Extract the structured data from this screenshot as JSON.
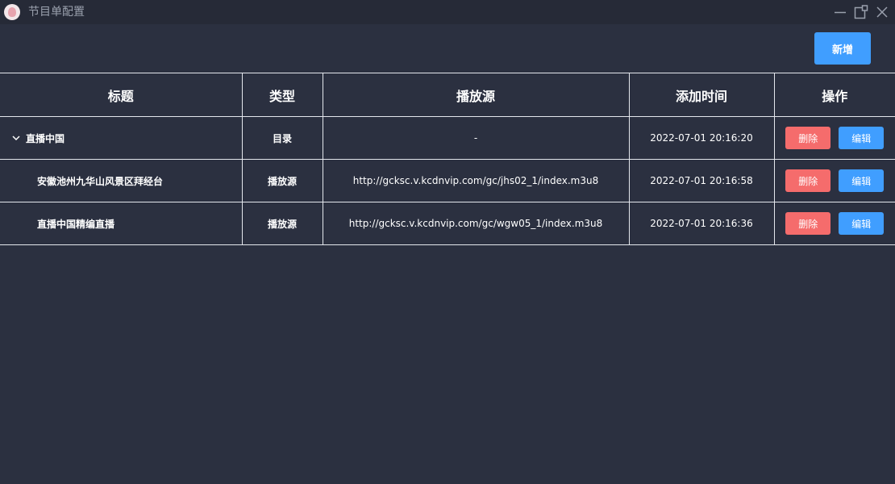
{
  "window": {
    "title": "节目单配置"
  },
  "toolbar": {
    "add_label": "新增"
  },
  "table": {
    "headers": [
      "标题",
      "类型",
      "播放源",
      "添加时间",
      "操作"
    ],
    "rows": [
      {
        "title": "直播中国",
        "type": "目录",
        "source": "-",
        "time": "2022-07-01 20:16:20",
        "delete_label": "删除",
        "edit_label": "编辑"
      },
      {
        "title": "安徽池州九华山风景区拜经台",
        "type": "播放源",
        "source": "http://gcksc.v.kcdnvip.com/gc/jhs02_1/index.m3u8",
        "time": "2022-07-01 20:16:58",
        "delete_label": "删除",
        "edit_label": "编辑"
      },
      {
        "title": "直播中国精编直播",
        "type": "播放源",
        "source": "http://gcksc.v.kcdnvip.com/gc/wgw05_1/index.m3u8",
        "time": "2022-07-01 20:16:36",
        "delete_label": "删除",
        "edit_label": "编辑"
      }
    ]
  },
  "colors": {
    "background": "#2b3040",
    "titlebar": "#262a37",
    "primary": "#409eff",
    "danger": "#f56c6c",
    "border": "#e4e7ed"
  },
  "icons": {
    "logo": "app-logo-icon",
    "minimize": "minimize-icon",
    "maximize": "maximize-icon",
    "close": "close-icon",
    "expand": "chevron-down-icon"
  }
}
